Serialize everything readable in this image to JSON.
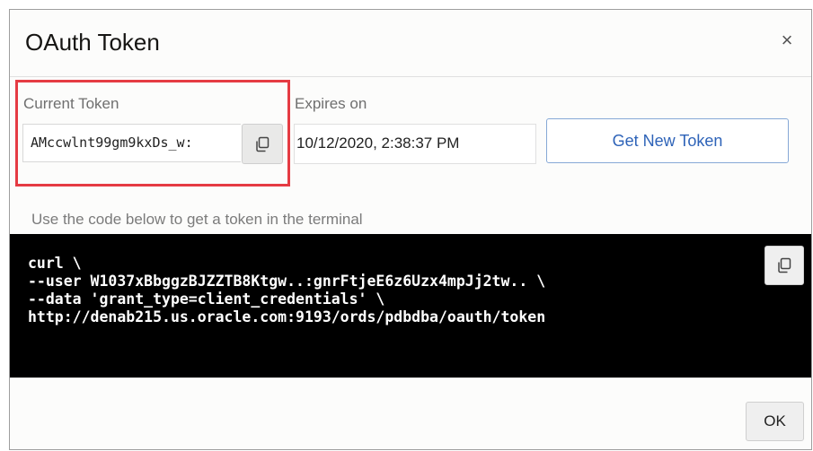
{
  "dialog": {
    "title": "OAuth Token",
    "close_symbol": "×"
  },
  "token": {
    "label": "Current Token",
    "value": "AMccwlnt99gm9kxDs_w:",
    "copy_icon": "copy-icon"
  },
  "expires": {
    "label": "Expires on",
    "value": "10/12/2020, 2:38:37 PM"
  },
  "get_new_token_label": "Get New Token",
  "hint": "Use the code below to get a token in the terminal",
  "code": {
    "text": "curl \\\n--user W1037xBbggzBJZZTB8Ktgw..:gnrFtjeE6z6Uzx4mpJj2tw.. \\\n--data 'grant_type=client_credentials' \\\nhttp://denab215.us.oracle.com:9193/ords/pdbdba/oauth/token",
    "copy_icon": "copy-icon"
  },
  "footer": {
    "ok_label": "OK"
  },
  "colors": {
    "highlight_box": "#e53b43",
    "primary_link": "#2e63b8",
    "code_background": "#000000"
  }
}
